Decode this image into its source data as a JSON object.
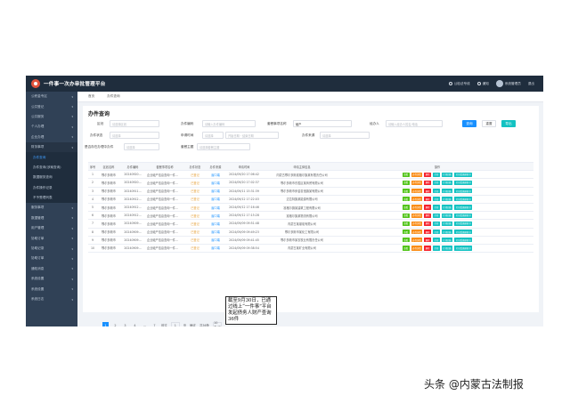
{
  "app": {
    "title": "一件事一次办审批管理平台"
  },
  "topbar": [
    "公检法专线",
    "通知",
    "系统管理员",
    "退出"
  ],
  "sidebar": [
    {
      "label": "公积金专区",
      "active": false,
      "sub": false
    },
    {
      "label": "公共登记",
      "active": false,
      "sub": false
    },
    {
      "label": "公共服务",
      "active": false,
      "sub": false
    },
    {
      "label": "个人办理",
      "active": false,
      "sub": false
    },
    {
      "label": "企业办理",
      "active": false,
      "sub": false
    },
    {
      "label": "财务事项",
      "active": true,
      "sub": false
    },
    {
      "label": "办件查询",
      "active": false,
      "sub": true,
      "current": true
    },
    {
      "label": "办件查询(涉案查询)",
      "active": false,
      "sub": true
    },
    {
      "label": "数据服务查询",
      "active": false,
      "sub": true
    },
    {
      "label": "办件操作记录",
      "active": false,
      "sub": true
    },
    {
      "label": "不予受理列表",
      "active": false,
      "sub": true
    },
    {
      "label": "服务事项",
      "active": false,
      "sub": false
    },
    {
      "label": "数据管理",
      "active": false,
      "sub": false
    },
    {
      "label": "用户管理",
      "active": false,
      "sub": false
    },
    {
      "label": "协助订单",
      "active": false,
      "sub": false
    },
    {
      "label": "协助记录",
      "active": false,
      "sub": false
    },
    {
      "label": "协助订单",
      "active": false,
      "sub": false
    },
    {
      "label": "通知消息",
      "active": false,
      "sub": false
    },
    {
      "label": "系统设置",
      "active": false,
      "sub": false
    },
    {
      "label": "系统设置",
      "active": false,
      "sub": false
    },
    {
      "label": "系统日志",
      "active": false,
      "sub": false
    }
  ],
  "tabs": [
    "首页",
    "办件查询"
  ],
  "page_title": "办件查询",
  "filters": {
    "area_label": "区划",
    "area_placeholder": "请选择区划",
    "code_label": "办件编码",
    "code_placeholder": "请输入办件编码",
    "type_label": "套餐事项名称",
    "type_value": "破产",
    "handler_label": "经办人",
    "handler_placeholder": "请输入经办人姓名/电话",
    "status_label": "办件状态",
    "status_value": "请选择",
    "date_label": "申请时间",
    "date_value": "请选择",
    "date_start": "开始日期",
    "date_end": "结束日期",
    "source_label": "办件来源",
    "source_value": "请选择",
    "refund_label": "是否存在办理中办件",
    "refund_value": "请选择",
    "subject_label": "套餐主题",
    "subject_value": "请选择套餐主题"
  },
  "buttons": {
    "search": "查询",
    "reset": "重置",
    "export": "导出"
  },
  "table": {
    "headers": [
      "序号",
      "区划名称",
      "办件编码",
      "套餐事项名称",
      "办件状态",
      "办件来源",
      "申请时间",
      "申请主体信息",
      "操作"
    ],
    "rows": [
      [
        "1",
        "鄂尔多斯市",
        "20240920...",
        "企业破产信息查询一件...",
        "已登记",
        "窗口端",
        "2024/09/20 17:06:42",
        "内蒙古鄂尔多斯准格尔旗某有限责任公司"
      ],
      [
        "2",
        "鄂尔多斯市",
        "20240920...",
        "企业破产信息查询一件...",
        "已登记",
        "窗口端",
        "2024/09/20 17:02:37",
        "鄂尔多斯市东胜区某商贸有限公司"
      ],
      [
        "3",
        "鄂尔多斯市",
        "20240911...",
        "企业破产信息查询一件...",
        "已登记",
        "窗口端",
        "2024/09/11 15:31:39",
        "鄂尔多斯市伊金霍洛旗某有限公司"
      ],
      [
        "4",
        "鄂尔多斯市",
        "20240912...",
        "企业破产信息查询一件...",
        "已登记",
        "窗口端",
        "2024/09/12 17:22:03",
        "达拉特旗某能源有限公司"
      ],
      [
        "5",
        "鄂尔多斯市",
        "20240912...",
        "企业破产信息查询一件...",
        "已登记",
        "窗口端",
        "2024/09/12 17:16:46",
        "准格尔旗某建筑工程有限公司"
      ],
      [
        "6",
        "鄂尔多斯市",
        "20240912...",
        "企业破产信息查询一件...",
        "已登记",
        "窗口端",
        "2024/09/12 17:15:28",
        "准格尔旗某物流有限公司"
      ],
      [
        "7",
        "鄂尔多斯市",
        "20240909...",
        "企业破产信息查询一件...",
        "已登记",
        "窗口端",
        "2024/09/09 09:51:48",
        "内蒙古某煤炭有限公司"
      ],
      [
        "8",
        "鄂尔多斯市",
        "20240909...",
        "企业破产信息查询一件...",
        "已登记",
        "窗口端",
        "2024/09/09 09:49:23",
        "鄂尔多斯市某化工有限公司"
      ],
      [
        "9",
        "鄂尔多斯市",
        "20240909...",
        "企业破产信息查询一件...",
        "已登记",
        "窗口端",
        "2024/09/09 09:41:45",
        "鄂尔多斯市某农牧业有限责任公司"
      ],
      [
        "10",
        "鄂尔多斯市",
        "20240909...",
        "企业破产信息查询一件...",
        "已登记",
        "窗口端",
        "2024/09/09 09:38:54",
        "内蒙古某矿业有限公司"
      ]
    ],
    "ops": [
      "查看",
      "办件详情",
      "删除",
      "打印",
      "打印回执",
      "打印受理通知书"
    ]
  },
  "pager": {
    "pages": [
      "1",
      "2",
      "3",
      "4",
      "...",
      "7"
    ],
    "goto_label": "前往",
    "page_value": "1",
    "page_suffix": "页",
    "confirm": "确定",
    "total": "共36条",
    "page_size": "10条/页"
  },
  "callout": "截至9月30日，已通过线上“一件事”平台发起债务人财产查询36件",
  "watermark": "头条 @内蒙古法制报",
  "colors": {
    "primary": "#1890ff",
    "sidebar": "#304156",
    "topbar": "#1f2d3d",
    "status": "#e6a23c"
  }
}
